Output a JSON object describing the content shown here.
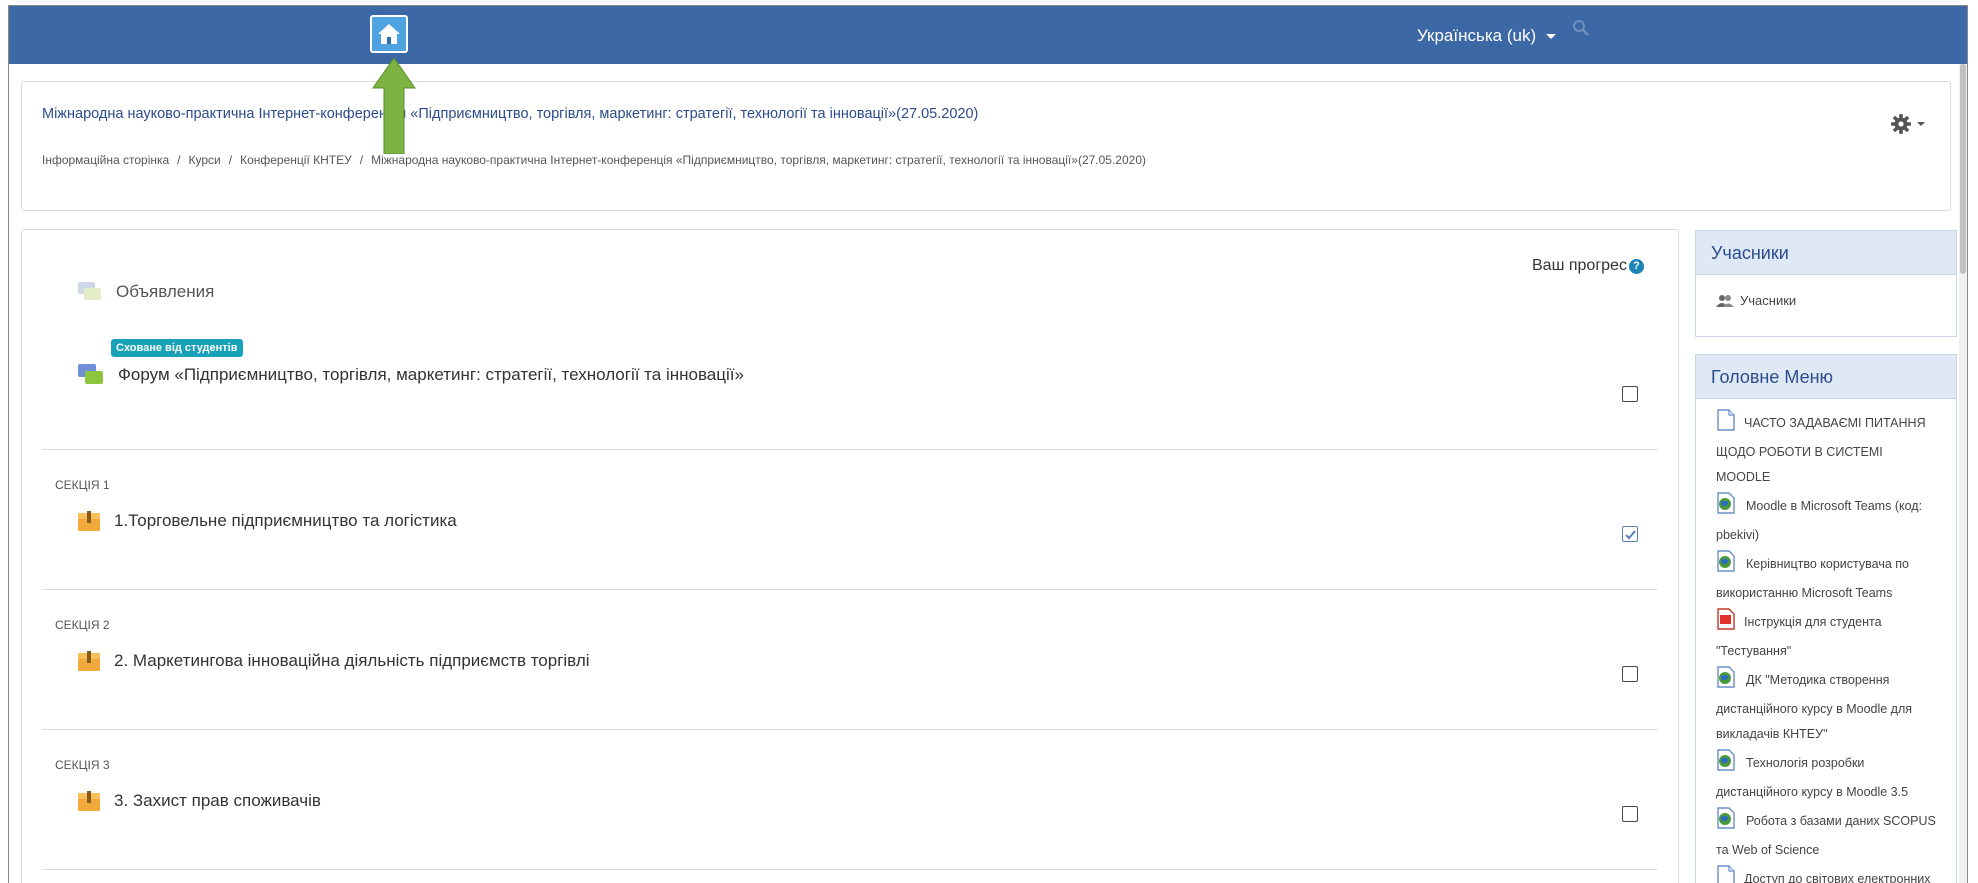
{
  "navbar": {
    "language": "Українська (uk)",
    "color": "#3d68a6"
  },
  "header": {
    "course_title": "Міжнародна науково-практична Інтернет-конференція «Підприємництво, торгівля, маркетинг: стратегії, технології та інновації»(27.05.2020)",
    "breadcrumb": [
      "Інформаційна сторінка",
      "Курси",
      "Конференції КНТЕУ",
      "Міжнародна науково-практична Інтернет-конференція «Підприємництво, торгівля, маркетинг: стратегії, технології та інновації»(27.05.2020)"
    ]
  },
  "main": {
    "progress_label": "Ваш прогрес",
    "help_glyph": "?",
    "announcements": "Объявления",
    "hidden_badge": "Сховане від студентів",
    "forum": "Форум «Підприємництво, торгівля, маркетинг: стратегії, технології та інновації»",
    "sections": [
      {
        "label": "Секція 1",
        "title": "1.Торговельне підприємництво та логістика",
        "completed": true
      },
      {
        "label": "Секція 2",
        "title": "2. Маркетингова інноваційна діяльність підприємств торгівлі",
        "completed": false
      },
      {
        "label": "Секція 3",
        "title": "3. Захист прав споживачів",
        "completed": false
      }
    ]
  },
  "sidebar": {
    "participants_block": {
      "title": "Учасники",
      "link": "Учасники"
    },
    "main_menu_block": {
      "title": "Головне Меню",
      "items": [
        {
          "icon": "file-icon",
          "text": "ЧАСТО ЗАДАВАЄМІ ПИТАННЯ ЩОДО РОБОТИ В СИСТЕМІ MOODLE"
        },
        {
          "icon": "url-globe-icon",
          "text": "Moodle в Microsoft Teams (код: pbekivi)"
        },
        {
          "icon": "url-globe-icon",
          "text": "Керівництво користувача по використанню Microsoft Teams"
        },
        {
          "icon": "pdf-icon",
          "text": "Інструкція для студента \"Тестування\""
        },
        {
          "icon": "url-globe-icon",
          "text": "ДК \"Методика створення дистанційного курсу в Moodle для викладачів КНТЕУ\""
        },
        {
          "icon": "url-globe-icon",
          "text": "Технологія розробки дистанційного курсу в Moodle 3.5"
        },
        {
          "icon": "url-globe-icon",
          "text": "Робота з базами даних SCOPUS та Web of Science"
        },
        {
          "icon": "file-icon",
          "text": "Доступ до світових електронних ресурсів"
        }
      ]
    }
  }
}
